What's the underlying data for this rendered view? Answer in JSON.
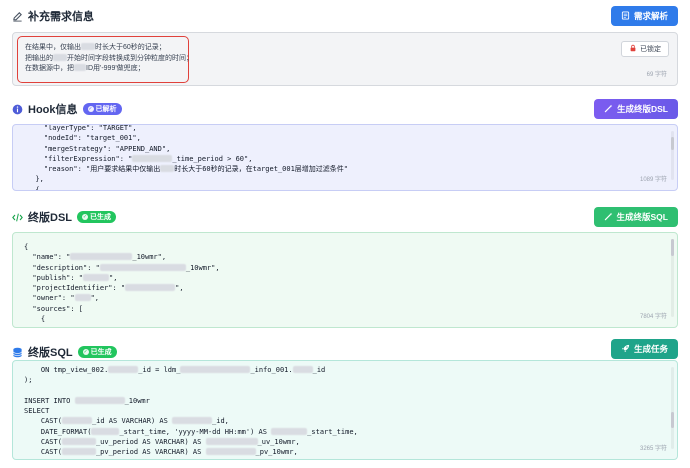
{
  "supplement": {
    "title": "补充需求信息",
    "button": "需求解析",
    "lines": [
      "在结果中，仅输出",
      "时长大于60秒的记录；",
      "把输出的",
      "开始时间字段转换成到分钟粒度的时间；",
      "在数据源中，把",
      "ID用'-999'做兜底；"
    ],
    "lock_label": "已锁定",
    "count": "69 字符"
  },
  "hook": {
    "title": "Hook信息",
    "badge": "已解析",
    "button": "生成终版DSL",
    "lines": [
      "    \"layerType\": \"TARGET\",",
      "    \"nodeId\": \"target_001\",",
      "    \"mergeStrategy\": \"APPEND_AND\",",
      "    \"filterExpression\": \"",
      "_time_period > 60\",",
      "    \"reason\": \"用户要求结果中仅输出",
      "时长大于60秒的记录，在target_001层增加过滤条件\"",
      "  },",
      "  {"
    ],
    "count": "1089 字符"
  },
  "dsl": {
    "title": "终版DSL",
    "badge": "已生成",
    "button": "生成终版SQL",
    "lines": [
      "{",
      "  \"name\": \"",
      "_10wmr\",",
      "  \"description\": \"",
      "_10wmr\",",
      "  \"publish\": \"",
      "\",",
      "  \"projectIdentifier\": \"",
      "\",",
      "  \"owner\": \"",
      "\",",
      "  \"sources\": [",
      "    {"
    ],
    "count": "7804 字符"
  },
  "sql": {
    "title": "终版SQL",
    "badge": "已生成",
    "button": "生成任务",
    "lines": [
      "    ON tmp_view_002.",
      "_id = ldm_",
      "_info_001.",
      "_id",
      ");",
      "INSERT INTO",
      "_10wmr",
      "SELECT",
      "    CAST(",
      "_id AS VARCHAR) AS",
      "_id,",
      "    DATE_FORMAT(",
      "_start_time, 'yyyy-MM-dd HH:mm') AS",
      "_start_time,",
      "    CAST(",
      "_uv_period AS VARCHAR) AS",
      "_uv_10wmr,",
      "    CAST(",
      "_pv_period AS VARCHAR) AS",
      "_pv_10wmr,"
    ],
    "count": "3265 字符"
  },
  "colors": {
    "supplement_bg": "#f3f4f6",
    "highlight_border": "#e0413b",
    "hook_bg": "#eef0fd",
    "hook_border": "#c7cdf5",
    "dsl_bg": "#effaf3",
    "dsl_border": "#bfe7cf",
    "sql_bg": "#edfaf7",
    "sql_border": "#b4e6da"
  }
}
